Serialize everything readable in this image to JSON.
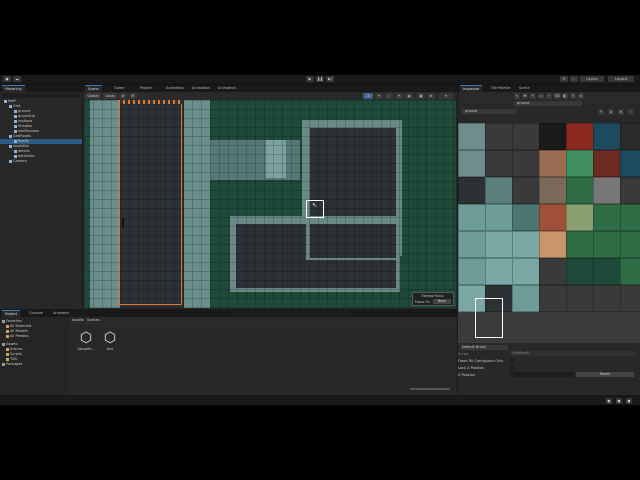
{
  "toolbar": {
    "play_icon": "play-icon",
    "pause_icon": "pause-icon",
    "step_icon": "step-icon",
    "layers_label": "Layers",
    "layout_label": "Layout"
  },
  "hierarchy": {
    "tab": "Hierarchy",
    "items": [
      {
        "label": "test*",
        "indent": 0,
        "selected": false
      },
      {
        "label": "Grid",
        "indent": 1,
        "selected": false
      },
      {
        "label": "ground",
        "indent": 2,
        "selected": false
      },
      {
        "label": "groundUp",
        "indent": 2,
        "selected": false
      },
      {
        "label": "rooftops",
        "indent": 2,
        "selected": false
      },
      {
        "label": "Shadow",
        "indent": 2,
        "selected": false
      },
      {
        "label": "wallShadow",
        "indent": 2,
        "selected": false
      },
      {
        "label": "GridRoads",
        "indent": 1,
        "selected": false
      },
      {
        "label": "Roads",
        "indent": 2,
        "selected": true
      },
      {
        "label": "roadsDot",
        "indent": 1,
        "selected": false
      },
      {
        "label": "details",
        "indent": 2,
        "selected": false
      },
      {
        "label": "detailsUp",
        "indent": 2,
        "selected": false
      },
      {
        "label": "Camera",
        "indent": 1,
        "selected": false
      }
    ]
  },
  "scene_tabs": [
    "Scene",
    "Game",
    "Project",
    "Animation",
    "Animation",
    "Animation"
  ],
  "scene_toolbar": {
    "global_label": "Global",
    "local_label": "Local",
    "mode_2d": "2D"
  },
  "overlay": {
    "title": "Tilemap Focus",
    "focus_label": "Focus On",
    "focus_value": "None"
  },
  "right_tabs": [
    "Inspector",
    "Tile Palette",
    "Scene"
  ],
  "palette": {
    "active_tilemap": "ground",
    "palette_name": "ground"
  },
  "brush": {
    "name": "Default Brush",
    "script_label": "Script",
    "script_value": "GridBrush",
    "flood_fill_label": "Flood Fill Contiguous Only",
    "lock_z_label": "Lock Z Position",
    "z_position_label": "Z Position",
    "reset_label": "Reset"
  },
  "project": {
    "tabs": [
      "Project",
      "Console",
      "Animator"
    ],
    "favorites_label": "Favorites",
    "favorites": [
      "All Materials",
      "All Models",
      "All Prefabs"
    ],
    "assets_label": "Assets",
    "asset_folders": [
      "Scenes",
      "Scripts",
      "TDS"
    ],
    "packages_label": "Packages",
    "breadcrumb_root": "Assets",
    "breadcrumb_current": "Scenes",
    "files": [
      "SampleS...",
      "test"
    ]
  },
  "colors": {
    "grass": "#1f4a3a",
    "road": "#2a2f30",
    "pavement": "#6e8f8b",
    "selection": "#e07a2a"
  }
}
